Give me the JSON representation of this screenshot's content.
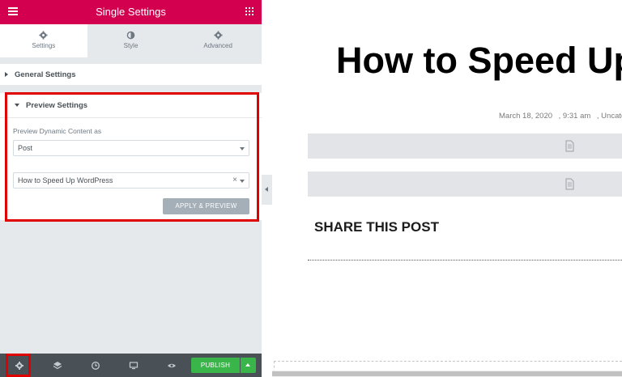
{
  "topbar": {
    "title": "Single Settings",
    "menu_icon": "hamburger-icon",
    "apps_icon": "grid-icon"
  },
  "tabs": [
    {
      "label": "Settings",
      "icon": "gear-icon",
      "active": true
    },
    {
      "label": "Style",
      "icon": "half-circle-icon",
      "active": false
    },
    {
      "label": "Advanced",
      "icon": "gear-icon",
      "active": false
    }
  ],
  "sections": {
    "general": {
      "title": "General Settings",
      "expanded": false
    },
    "preview": {
      "title": "Preview Settings",
      "expanded": true,
      "field_label": "Preview Dynamic Content as",
      "type_select": {
        "value": "Post"
      },
      "post_select": {
        "value": "How to Speed Up WordPress",
        "clear": "×"
      },
      "apply_button": "APPLY & PREVIEW"
    }
  },
  "bottombar": {
    "icons": [
      "gear-icon",
      "layers-icon",
      "history-icon",
      "desktop-icon",
      "eye-icon"
    ],
    "publish_label": "PUBLISH"
  },
  "preview": {
    "post_title": "How to Speed Up",
    "meta": {
      "date": "March 18, 2020",
      "time": ", 9:31 am",
      "category": ", Uncate"
    },
    "share_heading": "SHARE THIS POST"
  },
  "colors": {
    "accent": "#d3004f",
    "publish": "#39b54a",
    "highlight": "#e00000",
    "panel_bg": "#e6e9ec"
  }
}
